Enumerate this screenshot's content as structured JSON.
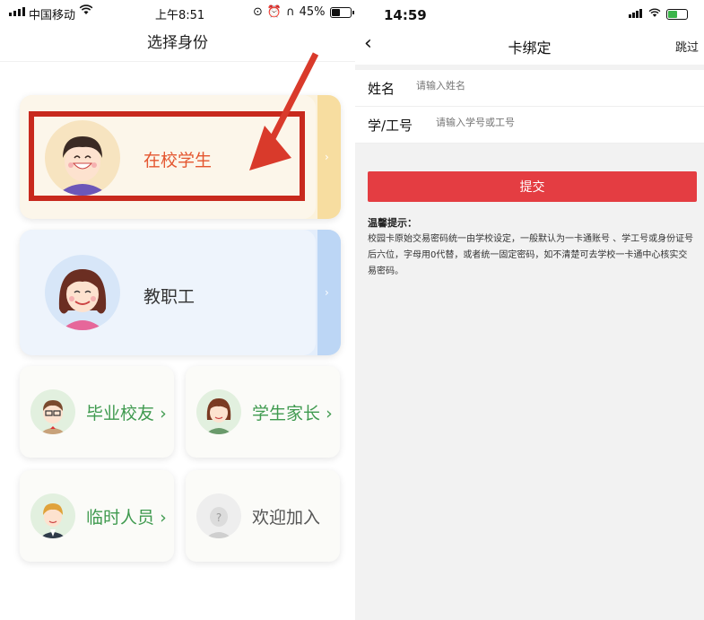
{
  "left_phone": {
    "status_bar": {
      "carrier": "中国移动",
      "time": "上午8:51",
      "battery": "45%",
      "battery_level": 0.45
    },
    "nav_title": "选择身份",
    "roles": {
      "student": {
        "label": "在校学生",
        "arrow": "›"
      },
      "staff": {
        "label": "教职工",
        "arrow": "›"
      },
      "alumni": {
        "label": "毕业校友",
        "arrow": "›"
      },
      "parent": {
        "label": "学生家长",
        "arrow": "›"
      },
      "temp": {
        "label": "临时人员",
        "arrow": "›"
      },
      "welcome": {
        "label": "欢迎加入"
      }
    },
    "colors": {
      "annotation_red": "#c8291d",
      "student_accent": "#e4562f",
      "green_text": "#3f9a4f"
    }
  },
  "right_phone": {
    "status_bar": {
      "time": "14:59"
    },
    "nav": {
      "back": "‹",
      "title": "卡绑定",
      "skip": "跳过"
    },
    "form": {
      "name_label": "姓名",
      "name_placeholder": "请输入姓名",
      "id_label": "学/工号",
      "id_placeholder": "请输入学号或工号"
    },
    "submit_label": "提交",
    "tip_title": "温馨提示：",
    "tip_body": "校园卡原始交易密码统一由学校设定，一般默认为一卡通账号 、学工号或身份证号后六位，字母用0代替，或者统一固定密码，如不清楚可去学校一卡通中心核实交易密码。",
    "colors": {
      "submit": "#e43d42",
      "background": "#f2f2f2"
    }
  }
}
